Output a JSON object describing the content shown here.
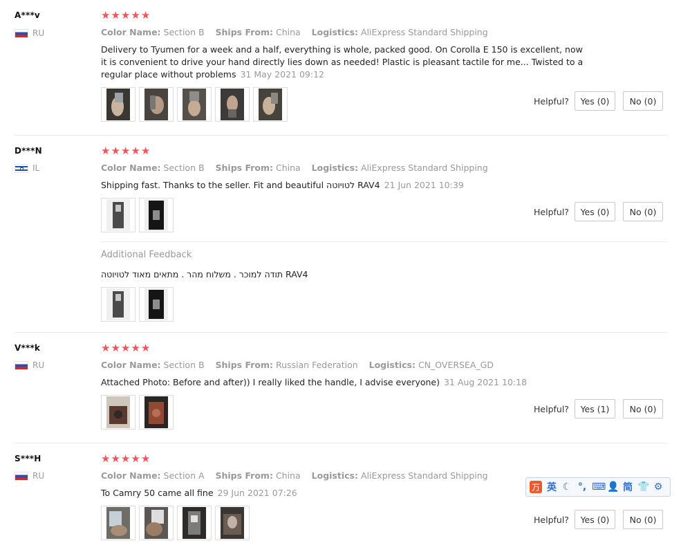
{
  "helpful_label": "Helpful?",
  "additional_feedback_label": "Additional Feedback",
  "star_glyph": "★",
  "star_color": "#f2545b",
  "reviews": [
    {
      "user": "A***v",
      "country": "RU",
      "rating": 5,
      "color_name_key": "Color Name:",
      "color_name": "Section B",
      "ships_from_key": "Ships From:",
      "ships_from": "China",
      "logistics_key": "Logistics:",
      "logistics": "AliExpress Standard Shipping",
      "text": "Delivery to Tyumen for a week and a half, everything is whole, packed good. On Corolla E 150 is excellent, now it is convenient to drive your hand directly lies down as needed! Plastic is pleasant tactile for me... Twisted to a regular place without problems",
      "date": "31 May 2021 09:12",
      "photos": 5,
      "yes": "Yes (0)",
      "no": "No (0)"
    },
    {
      "user": "D***N",
      "country": "IL",
      "rating": 5,
      "color_name_key": "Color Name:",
      "color_name": "Section B",
      "ships_from_key": "Ships From:",
      "ships_from": "China",
      "logistics_key": "Logistics:",
      "logistics": "AliExpress Standard Shipping",
      "text": "Shipping fast. Thanks to the seller. Fit and beautiful לטויוטה RAV4",
      "date": "21 Jun 2021 10:39",
      "photos": 2,
      "yes": "Yes (0)",
      "no": "No (0)",
      "additional": {
        "text": "תודה למוכר . משלוח מהר . מתאים מאוד לטויוטה RAV4",
        "photos": 2
      }
    },
    {
      "user": "V***k",
      "country": "RU",
      "rating": 5,
      "color_name_key": "Color Name:",
      "color_name": "Section B",
      "ships_from_key": "Ships From:",
      "ships_from": "Russian Federation",
      "logistics_key": "Logistics:",
      "logistics": "CN_OVERSEA_GD",
      "text": "Attached Photo: Before and after)) I really liked the handle, I advise everyone)",
      "date": "31 Aug 2021 10:18",
      "photos": 2,
      "yes": "Yes (1)",
      "no": "No (0)"
    },
    {
      "user": "S***H",
      "country": "RU",
      "rating": 5,
      "color_name_key": "Color Name:",
      "color_name": "Section A",
      "ships_from_key": "Ships From:",
      "ships_from": "China",
      "logistics_key": "Logistics:",
      "logistics": "AliExpress Standard Shipping",
      "text": "To Camry 50 came all fine",
      "date": "29 Jun 2021 07:26",
      "photos": 4,
      "yes": "Yes (0)",
      "no": "No (0)"
    }
  ],
  "ime_toolbar": {
    "logo": "万",
    "items": [
      "英",
      "☾",
      "°,",
      "⌨",
      "👤",
      "简",
      "👕",
      "⚙"
    ]
  }
}
